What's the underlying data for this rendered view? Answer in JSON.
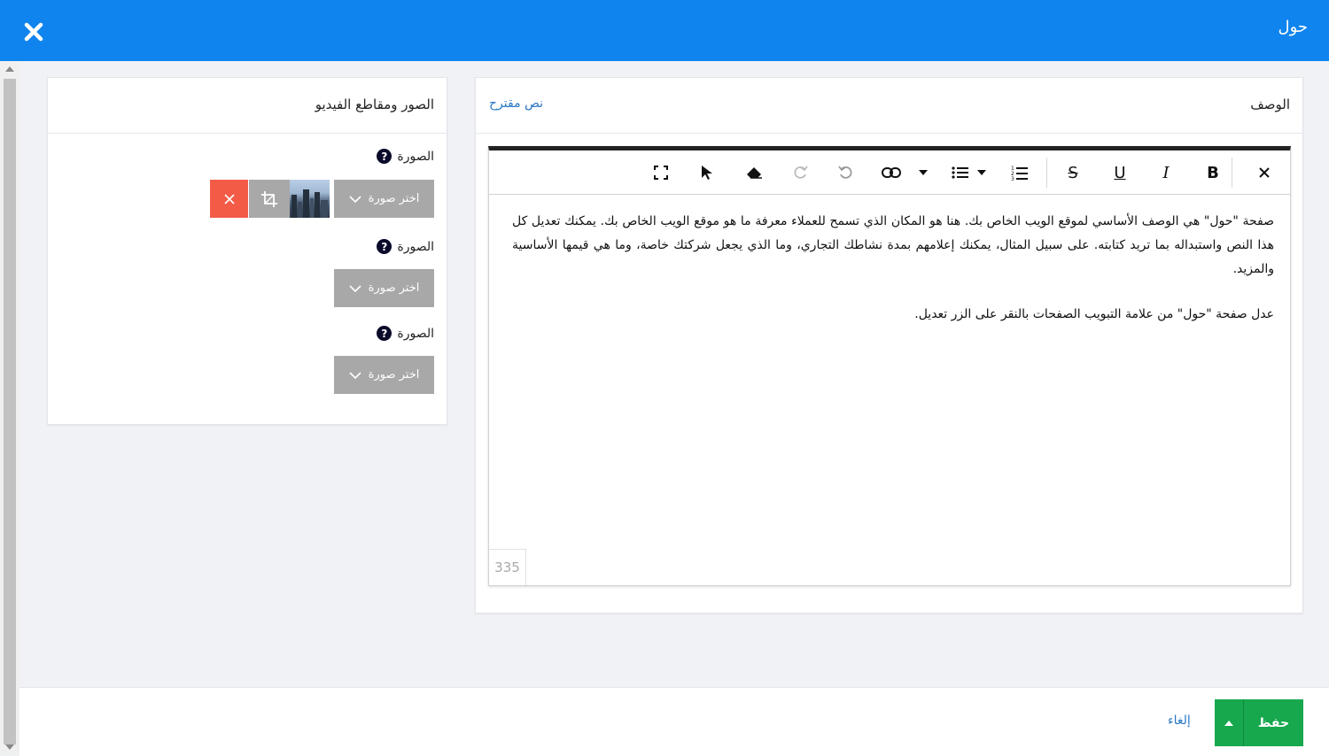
{
  "header": {
    "title": "حول",
    "close_icon": "close-icon",
    "background": "#0f84ee"
  },
  "media_panel": {
    "title": "الصور ومقاطع الفيديو",
    "slots": [
      {
        "label": "الصورة",
        "help": "?",
        "button_label": "اختر صورة",
        "has_image": true
      },
      {
        "label": "الصورة",
        "help": "?",
        "button_label": "اختر صورة",
        "has_image": false
      },
      {
        "label": "الصورة",
        "help": "?",
        "button_label": "اختر صورة",
        "has_image": false
      }
    ]
  },
  "description_panel": {
    "title": "الوصف",
    "suggested_link": "نص مقترح",
    "toolbar": [
      "close-icon",
      "bold-icon",
      "italic-icon",
      "underline-icon",
      "strikethrough-icon",
      "ordered-list-icon",
      "unordered-list-icon",
      "link-icon",
      "undo-icon",
      "redo-icon",
      "eraser-icon",
      "pointer-icon",
      "fullscreen-icon"
    ],
    "toolbar_labels": {
      "bold": "B",
      "italic": "I",
      "underline": "U",
      "strike": "S"
    },
    "paragraphs": [
      "صفحة \"حول\" هي الوصف الأساسي لموقع الويب الخاص بك. هنا هو المكان الذي تسمح للعملاء معرفة ما هو موقع الويب الخاص بك. يمكنك تعديل كل هذا النص واستبداله بما تريد كتابته. على سبيل المثال، يمكنك إعلامهم بمدة نشاطك التجاري، وما الذي يجعل شركتك خاصة، وما هي قيمها الأساسية والمزيد.",
      "عدل صفحة \"حول\" من علامة التبويب الصفحات بالنقر على الزر تعديل."
    ],
    "char_count": "335"
  },
  "footer": {
    "save_label": "حفظ",
    "cancel_label": "إلغاء",
    "save_color": "#17a84e"
  }
}
